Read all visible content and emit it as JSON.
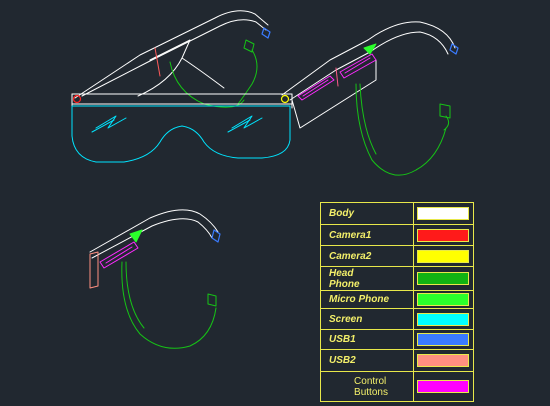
{
  "colors": {
    "background": "#212830",
    "frame": "#ffffff",
    "screen": "#00e5ff",
    "earpiece": "#16c316",
    "control": "#ff2bff",
    "usb1": "#3a7bff",
    "usb2": "#ff8f80",
    "red": "#ff2020",
    "yellow": "#ffff00",
    "legend_border": "#e8e84a"
  },
  "legend": {
    "items": [
      {
        "label": "Body",
        "color": "#ffffff",
        "style": "italic"
      },
      {
        "label": "Camera1",
        "color": "#ff1a1a",
        "style": "italic"
      },
      {
        "label": "Camera2",
        "color": "#ffff00",
        "style": "italic"
      },
      {
        "label": "Head\nPhone",
        "color": "#12b312",
        "style": "italic"
      },
      {
        "label": "Micro Phone",
        "color": "#2bff2b",
        "style": "italic"
      },
      {
        "label": "Screen",
        "color": "#00ffff",
        "style": "italic"
      },
      {
        "label": "USB1",
        "color": "#3a7bff",
        "style": "italic"
      },
      {
        "label": "USB2",
        "color": "#ff8f80",
        "style": "italic"
      },
      {
        "label": "Control\nButtons",
        "color": "#ff00ff",
        "style": "plain"
      }
    ]
  }
}
